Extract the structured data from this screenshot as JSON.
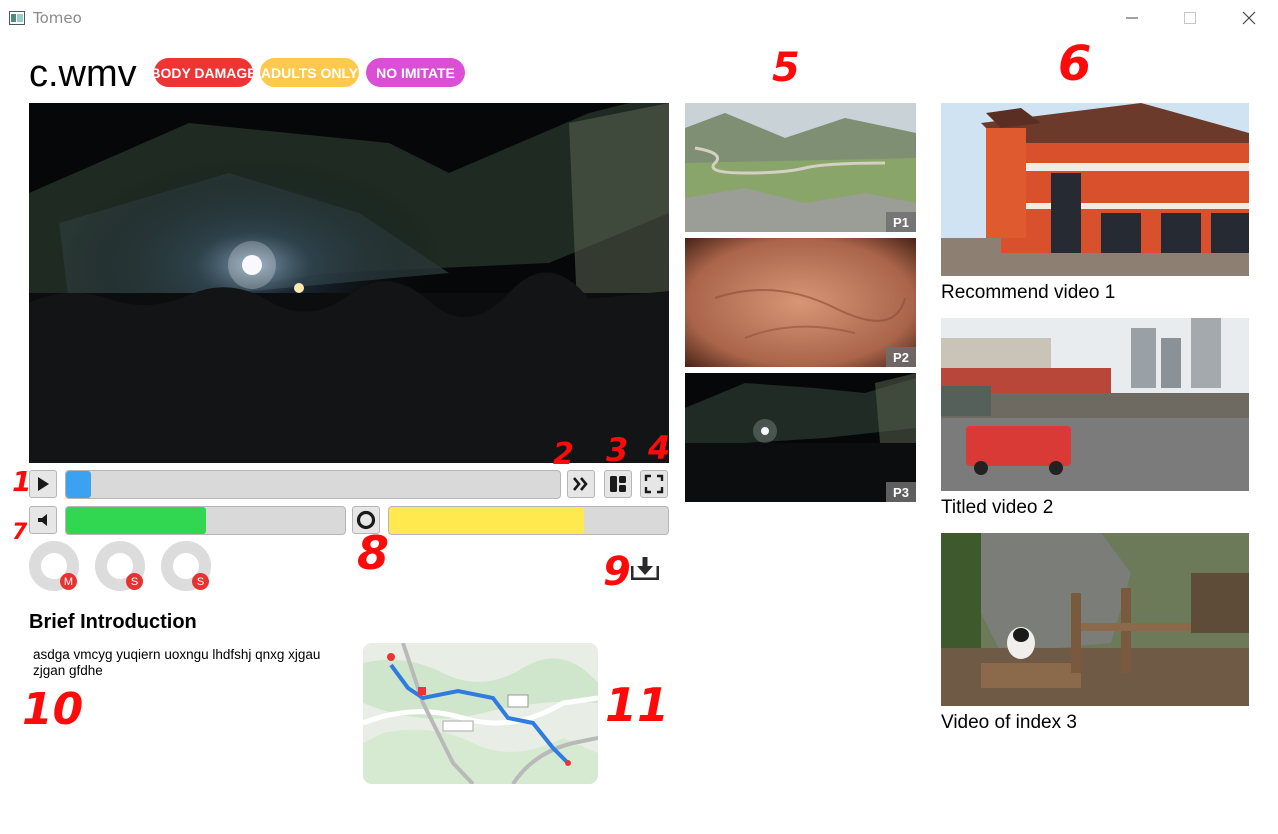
{
  "window": {
    "title": "Tomeo",
    "controls": [
      "minimize-icon",
      "maximize-icon",
      "close-icon"
    ]
  },
  "video": {
    "title": "c.wmv",
    "tags": [
      {
        "label": "BODY DAMAGE",
        "color": "#ef3434"
      },
      {
        "label": "ADULTS ONLY",
        "color": "#ffc94d"
      },
      {
        "label": "NO IMITATE",
        "color": "#db4fd6"
      }
    ],
    "progress": 0.05,
    "volume": 0.5,
    "speed": 0.7
  },
  "controls": {
    "play_icon": "play-icon",
    "next_icon": "double-chevron-right-icon",
    "layout_icon": "layout-grid-icon",
    "fullscreen_icon": "fullscreen-icon",
    "volume_icon": "speaker-icon",
    "record_icon": "record-icon",
    "download_icon": "download-icon"
  },
  "avatars": [
    {
      "badge": "M"
    },
    {
      "badge": "S"
    },
    {
      "badge": "S"
    }
  ],
  "intro": {
    "heading": "Brief Introduction",
    "text": "asdga vmcyg yuqiern uoxngu lhdfshj qnxg xjgau zjgan gfdhe"
  },
  "parts": [
    {
      "label": "P1"
    },
    {
      "label": "P2"
    },
    {
      "label": "P3"
    }
  ],
  "recommendations": [
    {
      "title": "Recommend video 1"
    },
    {
      "title": "Titled video 2"
    },
    {
      "title": "Video of index 3"
    }
  ],
  "annotations": [
    "1",
    "2",
    "3",
    "4",
    "5",
    "6",
    "7",
    "8",
    "9",
    "10",
    "11"
  ],
  "colors": {
    "progress": "#3aa2f0",
    "volume": "#31d651",
    "speed": "#ffe94f",
    "badge": "#e83232",
    "annotation": "#ff0a0a"
  }
}
